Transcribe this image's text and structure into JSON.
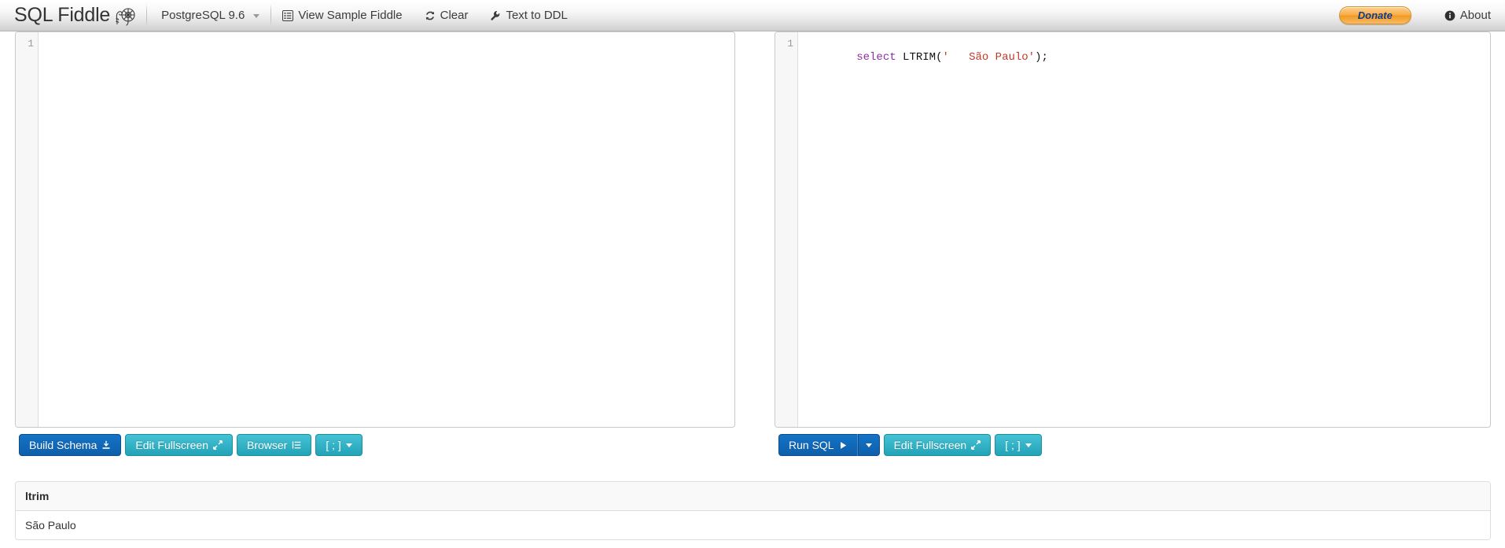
{
  "navbar": {
    "brand": {
      "text": "SQL Fiddle",
      "logo_icon": "fiddlehead-fern-logo"
    },
    "database": {
      "label": "PostgreSQL 9.6",
      "caret_icon": "chevron-down-icon"
    },
    "items": [
      {
        "label": "View Sample Fiddle",
        "icon": "list-alt-icon"
      },
      {
        "label": "Clear",
        "icon": "refresh-icon"
      },
      {
        "label": "Text to DDL",
        "icon": "wrench-icon"
      }
    ],
    "donate": {
      "label": "Donate"
    },
    "about": {
      "label": "About",
      "icon": "info-circle-icon"
    }
  },
  "schema_panel": {
    "line_number": "1",
    "code_plain": "",
    "buttons": [
      {
        "label": "Build Schema",
        "icon": "download-icon",
        "style": "primary"
      },
      {
        "label": "Edit Fullscreen",
        "icon": "resize-full-icon",
        "style": "info"
      },
      {
        "label": "Browser",
        "icon": "indent-icon",
        "style": "info"
      },
      {
        "label": "[ ; ]",
        "icon": "chevron-down-icon",
        "style": "info"
      }
    ]
  },
  "query_panel": {
    "line_number": "1",
    "code_plain": "select LTRIM('   São Paulo');",
    "code_tokens": [
      {
        "text": "select",
        "type": "keyword"
      },
      {
        "text": " ",
        "type": "plain"
      },
      {
        "text": "LTRIM",
        "type": "function"
      },
      {
        "text": "(",
        "type": "punct"
      },
      {
        "text": "'   São Paulo'",
        "type": "string"
      },
      {
        "text": ");",
        "type": "punct"
      }
    ],
    "buttons": [
      {
        "label": "Run SQL",
        "icon": "play-icon",
        "style": "primary"
      },
      {
        "label": "",
        "icon": "chevron-down-icon",
        "style": "primary"
      },
      {
        "label": "Edit Fullscreen",
        "icon": "resize-full-icon",
        "style": "info"
      },
      {
        "label": "[ ; ]",
        "icon": "chevron-down-icon",
        "style": "info"
      }
    ]
  },
  "results": {
    "columns": [
      "ltrim"
    ],
    "rows": [
      [
        "São Paulo"
      ]
    ]
  },
  "colors": {
    "primary_blue": "#0e5faa",
    "info_teal": "#23a3b8",
    "donate_orange": "#f2991f",
    "donate_text_blue": "#0b3c91",
    "sql_keyword": "#8b2fa3",
    "sql_string": "#c0392b"
  }
}
